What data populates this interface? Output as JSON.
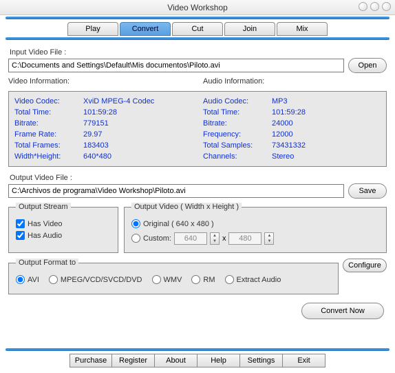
{
  "window": {
    "title": "Video Workshop"
  },
  "tabs": [
    "Play",
    "Convert",
    "Cut",
    "Join",
    "Mix"
  ],
  "active_tab": 1,
  "input": {
    "label": "Input Video File :",
    "path": "C:\\Documents and Settings\\Default\\Mis documentos\\Piloto.avi",
    "open": "Open"
  },
  "video_info": {
    "header": "Video Information:",
    "rows": [
      {
        "k": "Video Codec:",
        "v": "XviD MPEG-4 Codec"
      },
      {
        "k": "Total Time:",
        "v": "101:59:28"
      },
      {
        "k": "Bitrate:",
        "v": "779151"
      },
      {
        "k": "Frame Rate:",
        "v": "29.97"
      },
      {
        "k": "Total Frames:",
        "v": "183403"
      },
      {
        "k": "Width*Height:",
        "v": "640*480"
      }
    ]
  },
  "audio_info": {
    "header": "Audio Information:",
    "rows": [
      {
        "k": "Audio Codec:",
        "v": "MP3"
      },
      {
        "k": "Total Time:",
        "v": "101:59:28"
      },
      {
        "k": "Bitrate:",
        "v": "24000"
      },
      {
        "k": "Frequency:",
        "v": "12000"
      },
      {
        "k": "Total Samples:",
        "v": "73431332"
      },
      {
        "k": "Channels:",
        "v": "Stereo"
      }
    ]
  },
  "output": {
    "label": "Output Video File :",
    "path": "C:\\Archivos de programa\\Video Workshop\\Piloto.avi",
    "save": "Save"
  },
  "stream": {
    "legend": "Output Stream",
    "has_video": "Has Video",
    "has_audio": "Has Audio"
  },
  "dims": {
    "legend": "Output Video ( Width x Height )",
    "original": "Original ( 640 x 480 )",
    "custom": "Custom:",
    "w": "640",
    "h": "480",
    "x": "x"
  },
  "format": {
    "legend": "Output Format to",
    "opts": [
      "AVI",
      "MPEG/VCD/SVCD/DVD",
      "WMV",
      "RM",
      "Extract Audio"
    ],
    "configure": "Configure"
  },
  "convert_now": "Convert Now",
  "footer": [
    "Purchase",
    "Register",
    "About",
    "Help",
    "Settings",
    "Exit"
  ]
}
